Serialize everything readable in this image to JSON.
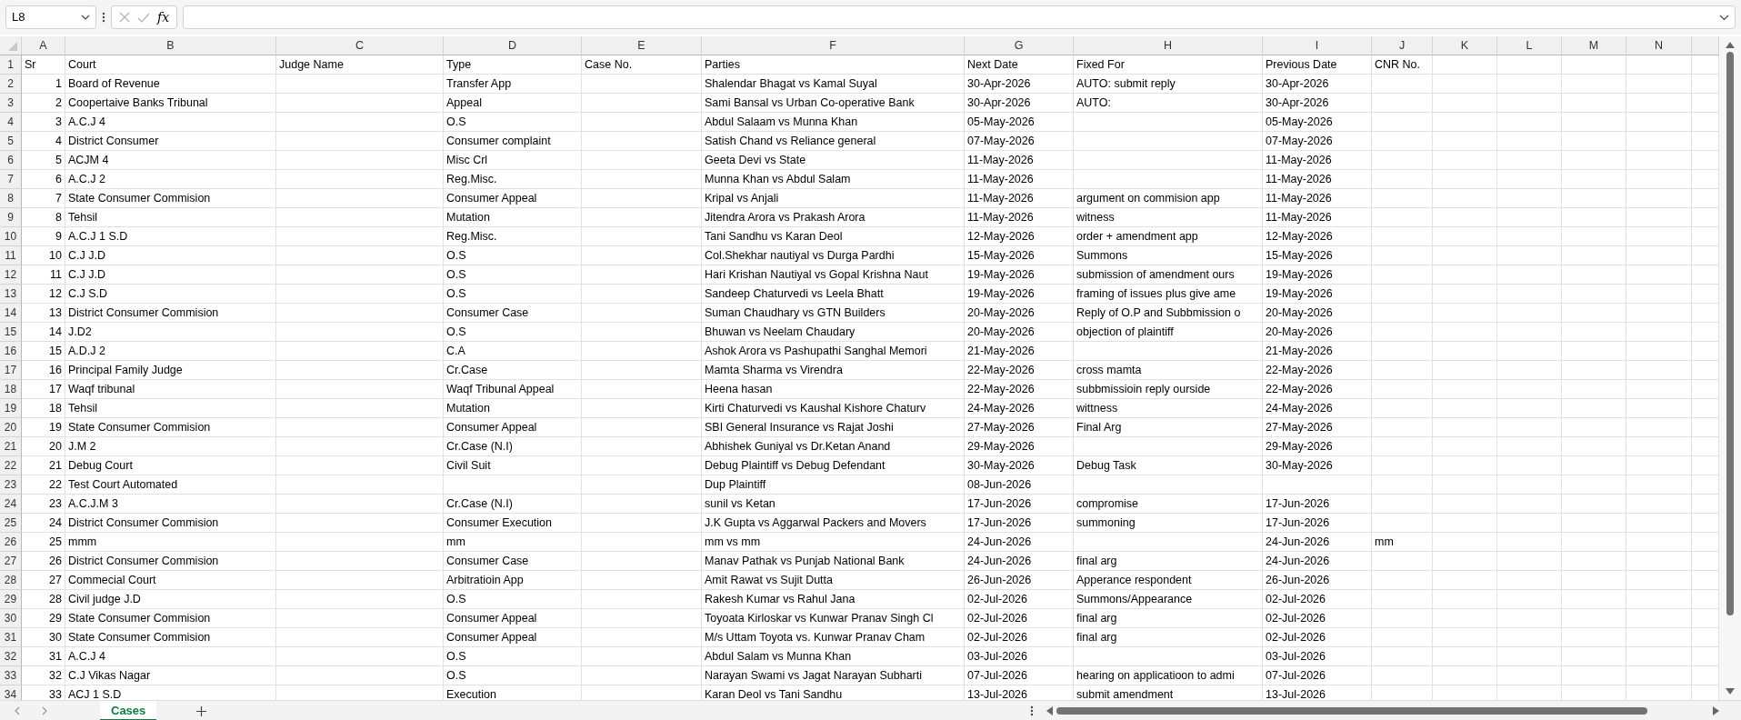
{
  "name_box": {
    "value": "L8"
  },
  "formula_bar": {
    "function_label": "fx"
  },
  "columns": [
    "A",
    "B",
    "C",
    "D",
    "E",
    "F",
    "G",
    "H",
    "I",
    "J",
    "K",
    "L",
    "M",
    "N"
  ],
  "rows": [
    {
      "number": "1",
      "A": "Sr",
      "B": "Court",
      "C": "Judge Name",
      "D": "Type",
      "E": "Case No.",
      "F": "Parties",
      "G": "Next Date",
      "H": "Fixed For",
      "I": "Previous Date",
      "J": "CNR No."
    },
    {
      "number": "2",
      "A": "1",
      "B": "Board of Revenue",
      "D": "Transfer App",
      "F": "Shalendar Bhagat vs Kamal Suyal",
      "G": "30-Apr-2026",
      "H": "AUTO: submit reply",
      "I": "30-Apr-2026"
    },
    {
      "number": "3",
      "A": "2",
      "B": "Coopertaive Banks Tribunal",
      "D": "Appeal",
      "F": "Sami Bansal vs Urban Co-operative Bank",
      "G": "30-Apr-2026",
      "H": "AUTO:",
      "I": "30-Apr-2026"
    },
    {
      "number": "4",
      "A": "3",
      "B": "A.C.J 4",
      "D": "O.S",
      "F": "Abdul Salaam vs Munna Khan",
      "G": "05-May-2026",
      "I": "05-May-2026"
    },
    {
      "number": "5",
      "A": "4",
      "B": "District Consumer",
      "D": "Consumer complaint",
      "F": "Satish Chand vs Reliance general",
      "G": "07-May-2026",
      "I": "07-May-2026"
    },
    {
      "number": "6",
      "A": "5",
      "B": "ACJM 4",
      "D": "Misc Crl",
      "F": "Geeta Devi vs State",
      "G": "11-May-2026",
      "I": "11-May-2026"
    },
    {
      "number": "7",
      "A": "6",
      "B": "A.C.J 2",
      "D": "Reg.Misc.",
      "F": "Munna Khan vs Abdul Salam",
      "G": "11-May-2026",
      "I": "11-May-2026"
    },
    {
      "number": "8",
      "A": "7",
      "B": "State Consumer Commision",
      "D": "Consumer Appeal",
      "F": "Kripal vs Anjali",
      "G": "11-May-2026",
      "H": "argument on commision app",
      "I": "11-May-2026"
    },
    {
      "number": "9",
      "A": "8",
      "B": "Tehsil",
      "D": "Mutation",
      "F": "Jitendra Arora vs Prakash Arora",
      "G": "11-May-2026",
      "H": "witness",
      "I": "11-May-2026"
    },
    {
      "number": "10",
      "A": "9",
      "B": "A.C.J 1 S.D",
      "D": "Reg.Misc.",
      "F": "Tani Sandhu vs Karan Deol",
      "G": "12-May-2026",
      "H": "order + amendment app",
      "I": "12-May-2026"
    },
    {
      "number": "11",
      "A": "10",
      "B": "C.J J.D",
      "D": "O.S",
      "F": "Col.Shekhar nautiyal vs Durga Pardhi",
      "G": "15-May-2026",
      "H": "Summons",
      "I": "15-May-2026"
    },
    {
      "number": "12",
      "A": "11",
      "B": "C.J J.D",
      "D": "O.S",
      "F": "Hari Krishan Nautiyal vs Gopal Krishna Naut",
      "G": "19-May-2026",
      "H": "submission of amendment ours",
      "I": "19-May-2026"
    },
    {
      "number": "13",
      "A": "12",
      "B": "C.J S.D",
      "D": "O.S",
      "F": "Sandeep Chaturvedi vs Leela Bhatt",
      "G": "19-May-2026",
      "H": "framing of issues plus give ame",
      "I": "19-May-2026"
    },
    {
      "number": "14",
      "A": "13",
      "B": "District Consumer Commision",
      "D": "Consumer Case",
      "F": "Suman Chaudhary vs GTN Builders",
      "G": "20-May-2026",
      "H": "Reply of O.P and Subbmission o",
      "I": "20-May-2026"
    },
    {
      "number": "15",
      "A": "14",
      "B": "J.D2",
      "D": "O.S",
      "F": "Bhuwan vs Neelam Chaudary",
      "G": "20-May-2026",
      "H": "objection of plaintiff",
      "I": "20-May-2026"
    },
    {
      "number": "16",
      "A": "15",
      "B": "A.D.J 2",
      "D": "C.A",
      "F": "Ashok Arora vs Pashupathi Sanghal Memori",
      "G": "21-May-2026",
      "I": "21-May-2026"
    },
    {
      "number": "17",
      "A": "16",
      "B": "Principal Family Judge",
      "D": "Cr.Case",
      "F": "Mamta Sharma vs Virendra",
      "G": "22-May-2026",
      "H": "cross mamta",
      "I": "22-May-2026"
    },
    {
      "number": "18",
      "A": "17",
      "B": "Waqf tribunal",
      "D": "Waqf Tribunal Appeal",
      "F": "Heena hasan",
      "G": "22-May-2026",
      "H": "subbmissioin reply ourside",
      "I": "22-May-2026"
    },
    {
      "number": "19",
      "A": "18",
      "B": "Tehsil",
      "D": "Mutation",
      "F": "Kirti Chaturvedi vs Kaushal Kishore Chaturv",
      "G": "24-May-2026",
      "H": "wittness",
      "I": "24-May-2026"
    },
    {
      "number": "20",
      "A": "19",
      "B": "State Consumer Commision",
      "D": "Consumer Appeal",
      "F": "SBI General Insurance vs Rajat Joshi",
      "G": "27-May-2026",
      "H": "Final Arg",
      "I": "27-May-2026"
    },
    {
      "number": "21",
      "A": "20",
      "B": "J.M 2",
      "D": "Cr.Case (N.I)",
      "F": "Abhishek Guniyal vs Dr.Ketan Anand",
      "G": "29-May-2026",
      "I": "29-May-2026"
    },
    {
      "number": "22",
      "A": "21",
      "B": "Debug Court",
      "D": "Civil Suit",
      "F": "Debug Plaintiff vs Debug Defendant",
      "G": "30-May-2026",
      "H": "Debug Task",
      "I": "30-May-2026"
    },
    {
      "number": "23",
      "A": "22",
      "B": "Test Court Automated",
      "F": "Dup Plaintiff",
      "G": "08-Jun-2026"
    },
    {
      "number": "24",
      "A": "23",
      "B": "A.C.J.M 3",
      "D": "Cr.Case (N.I)",
      "F": "sunil vs Ketan",
      "G": "17-Jun-2026",
      "H": "compromise",
      "I": "17-Jun-2026"
    },
    {
      "number": "25",
      "A": "24",
      "B": "District Consumer Commision",
      "D": "Consumer Execution",
      "F": "J.K Gupta vs Aggarwal Packers and Movers",
      "G": "17-Jun-2026",
      "H": "summoning",
      "I": "17-Jun-2026"
    },
    {
      "number": "26",
      "A": "25",
      "B": "mmm",
      "D": "mm",
      "F": "mm vs mm",
      "G": "24-Jun-2026",
      "I": "24-Jun-2026",
      "J": "mm"
    },
    {
      "number": "27",
      "A": "26",
      "B": "District Consumer Commision",
      "D": "Consumer Case",
      "F": "Manav Pathak vs Punjab National Bank",
      "G": "24-Jun-2026",
      "H": "final arg",
      "I": "24-Jun-2026"
    },
    {
      "number": "28",
      "A": "27",
      "B": "Commecial Court",
      "D": "Arbitratioin App",
      "F": "Amit Rawat vs Sujit Dutta",
      "G": "26-Jun-2026",
      "H": "Apperance respondent",
      "I": "26-Jun-2026"
    },
    {
      "number": "29",
      "A": "28",
      "B": "Civil judge  J.D",
      "D": "O.S",
      "F": "Rakesh Kumar vs Rahul Jana",
      "G": "02-Jul-2026",
      "H": "Summons/Appearance",
      "I": "02-Jul-2026"
    },
    {
      "number": "30",
      "A": "29",
      "B": "State Consumer Commision",
      "D": "Consumer Appeal",
      "F": "Toyoata Kirloskar vs Kunwar Pranav Singh Cl",
      "G": "02-Jul-2026",
      "H": "final arg",
      "I": "02-Jul-2026"
    },
    {
      "number": "31",
      "A": "30",
      "B": "State Consumer Commision",
      "D": "Consumer Appeal",
      "F": "M/s Uttam Toyota vs. Kunwar Pranav Cham",
      "G": "02-Jul-2026",
      "H": "final arg",
      "I": "02-Jul-2026"
    },
    {
      "number": "32",
      "A": "31",
      "B": "A.C.J 4",
      "D": "O.S",
      "F": "Abdul Salam vs Munna Khan",
      "G": "03-Jul-2026",
      "I": "03-Jul-2026"
    },
    {
      "number": "33",
      "A": "32",
      "B": "C.J Vikas Nagar",
      "D": "O.S",
      "F": "Narayan Swami vs Jagat Narayan Subharti",
      "G": "07-Jul-2026",
      "H": "hearing on applicatioon to admi",
      "I": "07-Jul-2026"
    },
    {
      "number": "34",
      "A": "33",
      "B": "ACJ 1 S.D",
      "D": "Execution",
      "F": "Karan Deol vs Tani Sandhu",
      "G": "13-Jul-2026",
      "H": "submit amendment",
      "I": "13-Jul-2026"
    }
  ],
  "sheet_tabs": [
    {
      "label": "Cases",
      "selected": true
    }
  ]
}
